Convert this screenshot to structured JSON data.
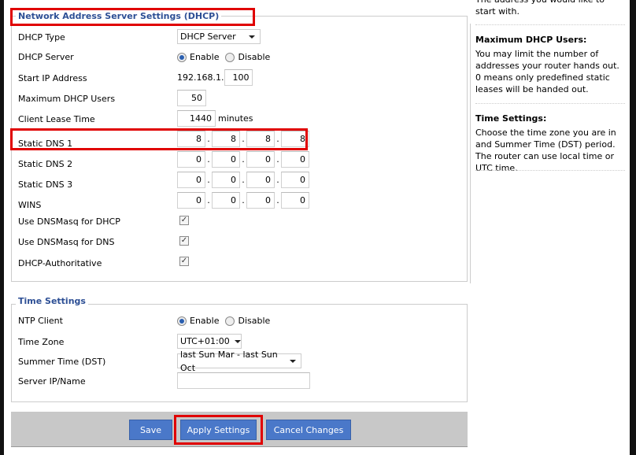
{
  "dhcp": {
    "legend": "Network Address Server Settings (DHCP)",
    "dhcp_type": {
      "label": "DHCP Type",
      "value": "DHCP Server"
    },
    "dhcp_server": {
      "label": "DHCP Server",
      "enable": "Enable",
      "disable": "Disable",
      "selected": "Enable"
    },
    "start_ip": {
      "label": "Start IP Address",
      "prefix": "192.168.1.",
      "value": "100"
    },
    "max_users": {
      "label": "Maximum DHCP Users",
      "value": "50"
    },
    "lease": {
      "label": "Client Lease Time",
      "value": "1440",
      "unit": "minutes"
    },
    "dns1": {
      "label": "Static DNS 1",
      "octets": [
        "8",
        "8",
        "8",
        "8"
      ]
    },
    "dns2": {
      "label": "Static DNS 2",
      "octets": [
        "0",
        "0",
        "0",
        "0"
      ]
    },
    "dns3": {
      "label": "Static DNS 3",
      "octets": [
        "0",
        "0",
        "0",
        "0"
      ]
    },
    "wins": {
      "label": "WINS",
      "octets": [
        "0",
        "0",
        "0",
        "0"
      ]
    },
    "dnsmasq_dhcp": {
      "label": "Use DNSMasq for DHCP",
      "checked": true
    },
    "dnsmasq_dns": {
      "label": "Use DNSMasq for DNS",
      "checked": true
    },
    "authoritative": {
      "label": "DHCP-Authoritative",
      "checked": true
    }
  },
  "time": {
    "legend": "Time Settings",
    "ntp": {
      "label": "NTP Client",
      "enable": "Enable",
      "disable": "Disable",
      "selected": "Enable"
    },
    "zone": {
      "label": "Time Zone",
      "value": "UTC+01:00"
    },
    "dst": {
      "label": "Summer Time (DST)",
      "value": "last Sun Mar - last Sun Oct"
    },
    "server": {
      "label": "Server IP/Name",
      "value": ""
    }
  },
  "buttons": {
    "save": "Save",
    "apply": "Apply Settings",
    "cancel": "Cancel Changes"
  },
  "help": {
    "start_tail": "The address you would like to start with.",
    "max_title": "Maximum DHCP Users:",
    "max_text": "You may limit the number of addresses your router hands out. 0 means only predefined static leases will be handed out.",
    "time_title": "Time Settings:",
    "time_text": "Choose the time zone you are in and Summer Time (DST) period. The router can use local time or UTC time."
  },
  "colors": {
    "legend": "#2d4f95",
    "button": "#4a78c9",
    "highlight": "#e00000",
    "button_bar": "#c8c8c8"
  }
}
